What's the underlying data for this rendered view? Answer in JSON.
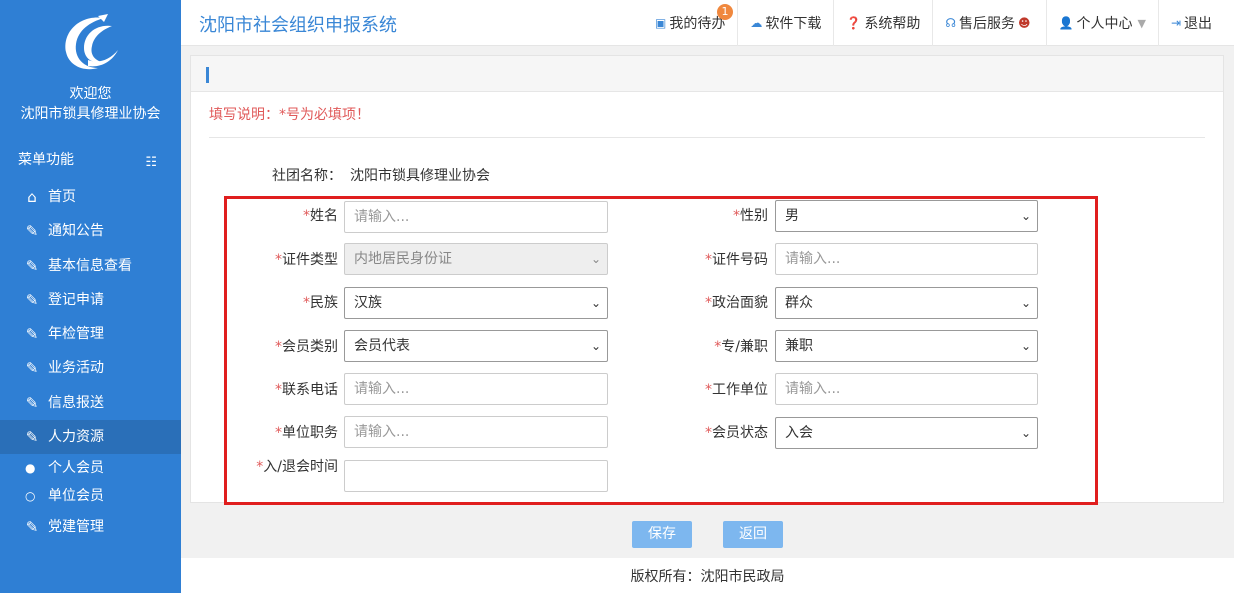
{
  "sidebar": {
    "welcome": "欢迎您",
    "org_name": "沈阳市锁具修理业协会",
    "menu_title": "菜单功能",
    "items": [
      {
        "label": "首页",
        "icon": "home-icon"
      },
      {
        "label": "通知公告",
        "icon": "edit-icon"
      },
      {
        "label": "基本信息查看",
        "icon": "edit-icon"
      },
      {
        "label": "登记申请",
        "icon": "edit-icon"
      },
      {
        "label": "年检管理",
        "icon": "edit-icon"
      },
      {
        "label": "业务活动",
        "icon": "edit-icon"
      },
      {
        "label": "信息报送",
        "icon": "edit-icon"
      },
      {
        "label": "人力资源",
        "icon": "edit-icon",
        "active": true
      }
    ],
    "sub_items": [
      {
        "label": "个人会员",
        "selected": true
      },
      {
        "label": "单位会员",
        "selected": false
      }
    ],
    "last_item": {
      "label": "党建管理",
      "icon": "edit-icon"
    }
  },
  "header": {
    "title": "沈阳市社会组织申报系统",
    "nav": [
      {
        "label": "我的待办",
        "badge": "1"
      },
      {
        "label": "软件下载"
      },
      {
        "label": "系统帮助"
      },
      {
        "label": "售后服务"
      },
      {
        "label": "个人中心"
      },
      {
        "label": "退出"
      }
    ]
  },
  "form": {
    "note": "填写说明：*号为必填项！",
    "org_label": "社团名称：",
    "org_value": "沈阳市锁具修理业协会",
    "required_mark": "*",
    "fields": {
      "name": {
        "label": "姓名",
        "placeholder": "请输入..."
      },
      "gender": {
        "label": "性别",
        "value": "男"
      },
      "id_type": {
        "label": "证件类型",
        "value": "内地居民身份证"
      },
      "id_number": {
        "label": "证件号码",
        "placeholder": "请输入..."
      },
      "ethnicity": {
        "label": "民族",
        "value": "汉族"
      },
      "political": {
        "label": "政治面貌",
        "value": "群众"
      },
      "member_type": {
        "label": "会员类别",
        "value": "会员代表"
      },
      "job_type": {
        "label": "专/兼职",
        "value": "兼职"
      },
      "phone": {
        "label": "联系电话",
        "placeholder": "请输入..."
      },
      "workplace": {
        "label": "工作单位",
        "placeholder": "请输入..."
      },
      "position": {
        "label": "单位职务",
        "placeholder": "请输入..."
      },
      "member_status": {
        "label": "会员状态",
        "value": "入会"
      },
      "join_time": {
        "label": "入/退会时间",
        "value": ""
      }
    },
    "save_label": "保存",
    "back_label": "返回"
  },
  "footer": {
    "copyright": "版权所有：沈阳市民政局"
  },
  "colors": {
    "sidebar": "#2f7fd4",
    "accent": "#3a87d6",
    "required": "#e05a5a",
    "highlight_box": "#e01e1e",
    "button": "#7db7ef"
  }
}
